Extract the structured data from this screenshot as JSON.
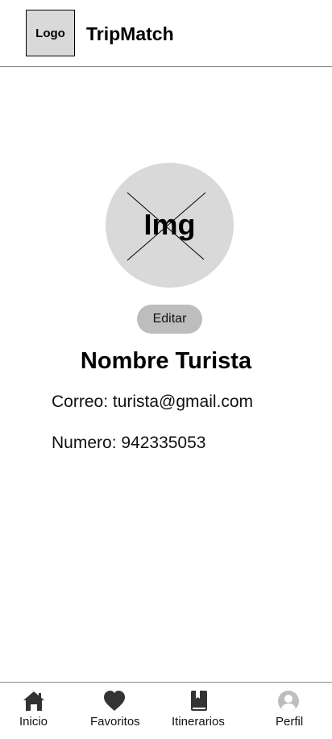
{
  "header": {
    "logo_text": "Logo",
    "app_title": "TripMatch"
  },
  "profile": {
    "avatar_text": "Img",
    "edit_label": "Editar",
    "name": "Nombre Turista",
    "email_line": "Correo: turista@gmail.com",
    "phone_line": "Numero: 942335053"
  },
  "nav": {
    "items": [
      {
        "label": "Inicio",
        "icon": "home-icon"
      },
      {
        "label": "Favoritos",
        "icon": "heart-icon"
      },
      {
        "label": "Itinerarios",
        "icon": "book-icon"
      },
      {
        "label": "Perfil",
        "icon": "user-icon",
        "active": true
      }
    ]
  },
  "colors": {
    "placeholder": "#d9d9d9",
    "button": "#bdbdbd",
    "icon": "#333333",
    "icon_active": "#bdbdbd"
  }
}
